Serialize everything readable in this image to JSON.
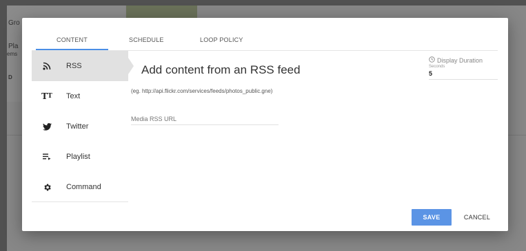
{
  "background": {
    "texts": [
      "Gro",
      "Pla",
      "ems",
      "D"
    ]
  },
  "dialog": {
    "tabs": [
      {
        "label": "CONTENT",
        "active": true
      },
      {
        "label": "SCHEDULE",
        "active": false
      },
      {
        "label": "LOOP POLICY",
        "active": false
      }
    ],
    "sidebar": {
      "items": [
        {
          "label": "RSS",
          "icon": "rss-icon",
          "active": true
        },
        {
          "label": "Text",
          "icon": "text-icon",
          "active": false
        },
        {
          "label": "Twitter",
          "icon": "twitter-icon",
          "active": false
        },
        {
          "label": "Playlist",
          "icon": "playlist-icon",
          "active": false
        },
        {
          "label": "Command",
          "icon": "gear-icon",
          "active": false
        }
      ]
    },
    "main": {
      "title": "Add content from an RSS feed",
      "example": "(eg. http://api.flickr.com/services/feeds/photos_public.gne)",
      "url_placeholder": "Media RSS URL",
      "url_value": ""
    },
    "duration": {
      "label": "Display Duration",
      "unit": "Seconds",
      "value": "5"
    },
    "buttons": {
      "save": "SAVE",
      "cancel": "CANCEL"
    },
    "colors": {
      "accent": "#4a8ee6",
      "save_button": "#5b94e5",
      "active_item": "#e1e1e1"
    }
  }
}
